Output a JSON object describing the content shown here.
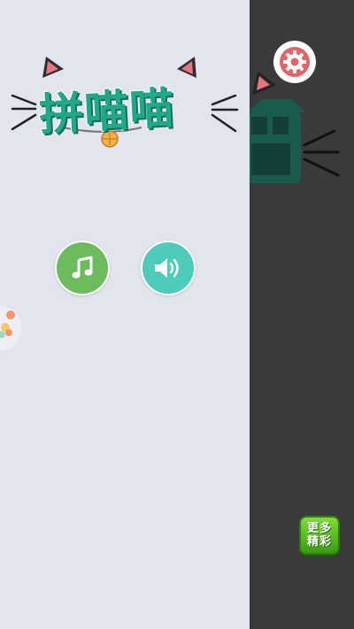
{
  "game": {
    "title": "拼喵喵"
  },
  "drawer": {
    "music_icon": "music-note-icon",
    "sound_icon": "speaker-volume-icon"
  },
  "settings": {
    "icon": "gear-icon"
  },
  "more_games": {
    "line1": "更多",
    "line2": "精彩"
  },
  "colors": {
    "drawer_bg": "#e2e4ee",
    "backdrop": "#3a3a3c",
    "title_green": "#1fa88a",
    "music_green": "#6cbb5c",
    "sound_teal": "#4ecbbb",
    "gear_red": "#e0646a",
    "more_green": "#5bbd26"
  }
}
